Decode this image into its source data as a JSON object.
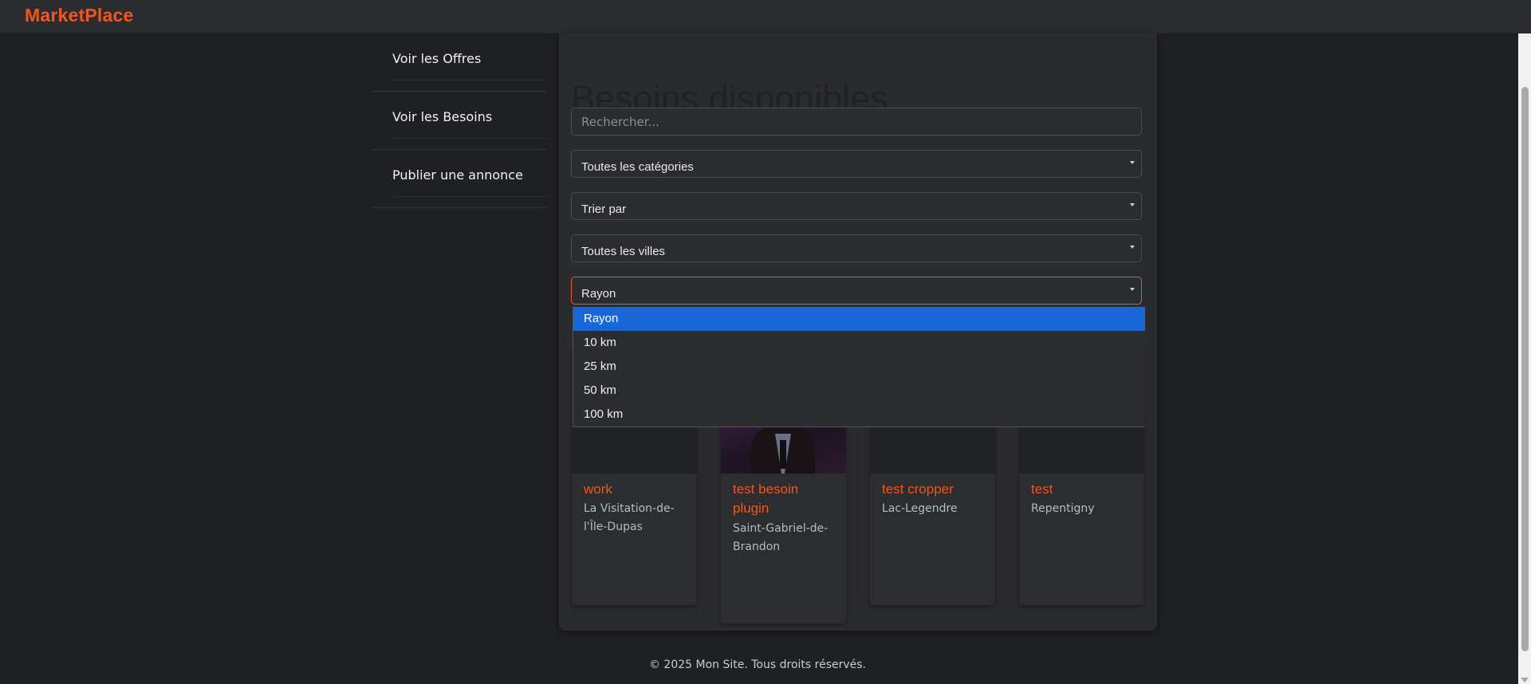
{
  "app": {
    "brand": "MarketPlace"
  },
  "sidebar": {
    "items": [
      {
        "label": "Voir les Offres"
      },
      {
        "label": "Voir les Besoins"
      },
      {
        "label": "Publier une annonce"
      }
    ]
  },
  "main": {
    "title": "Besoins disponibles",
    "search": {
      "placeholder": "Rechercher...",
      "value": ""
    },
    "filters": {
      "category": "Toutes les catégories",
      "sort": "Trier par",
      "city": "Toutes les villes",
      "radius": "Rayon"
    },
    "radius_options": [
      "Rayon",
      "10 km",
      "25 km",
      "50 km",
      "100 km"
    ],
    "cards": [
      {
        "title": "work",
        "city": "La Visitation-de-l'Île-Dupas"
      },
      {
        "title": "test besoin plugin",
        "city": "Saint-Gabriel-de-Brandon"
      },
      {
        "title": "test cropper",
        "city": "Lac-Legendre"
      },
      {
        "title": "test",
        "city": "Repentigny"
      }
    ]
  },
  "footer": {
    "text": "© 2025 Mon Site. Tous droits réservés."
  },
  "colors": {
    "accent": "#f0561d",
    "background": "#1f2023",
    "panel": "#2a2b2e",
    "selected_option": "#1a67d8"
  }
}
